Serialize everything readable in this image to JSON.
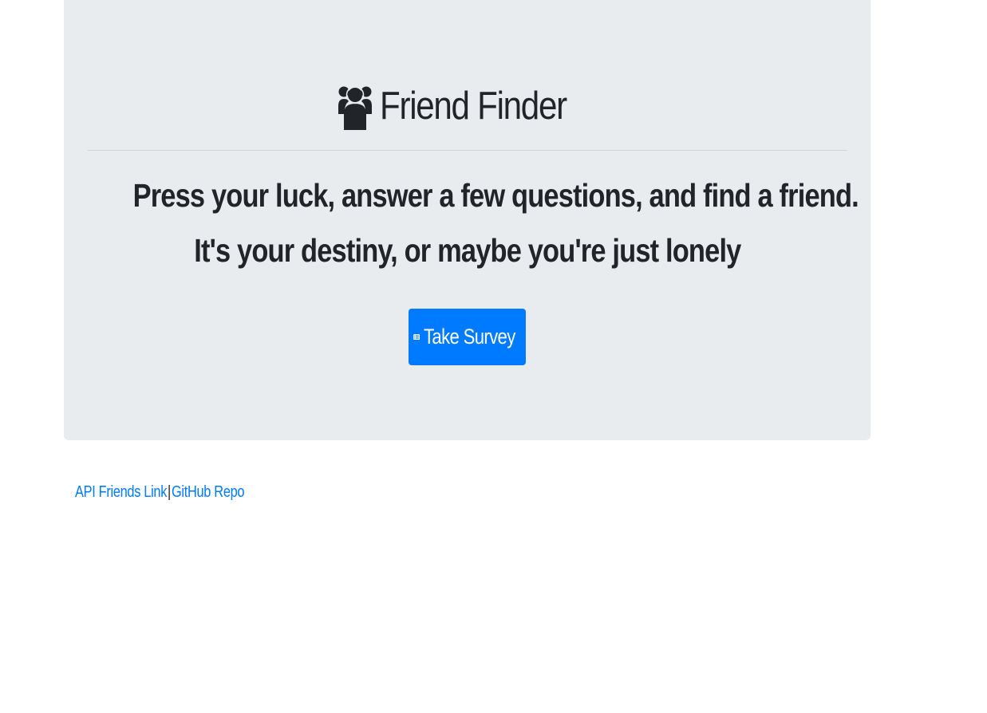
{
  "header": {
    "title": "Friend Finder",
    "icon": "users-icon"
  },
  "lead": {
    "line1": "Press your luck, answer a few questions, and find a friend.",
    "line2": "It's your destiny, or maybe you're just lonely"
  },
  "actions": {
    "survey_label": "Take Survey",
    "survey_icon": "list-alt-icon"
  },
  "footer": {
    "api_link_label": "API Friends Link",
    "separator": "|",
    "github_link_label": "GitHub Repo"
  },
  "colors": {
    "primary": "#007bff",
    "jumbotron_bg": "#e9ecef",
    "text": "#212529"
  }
}
